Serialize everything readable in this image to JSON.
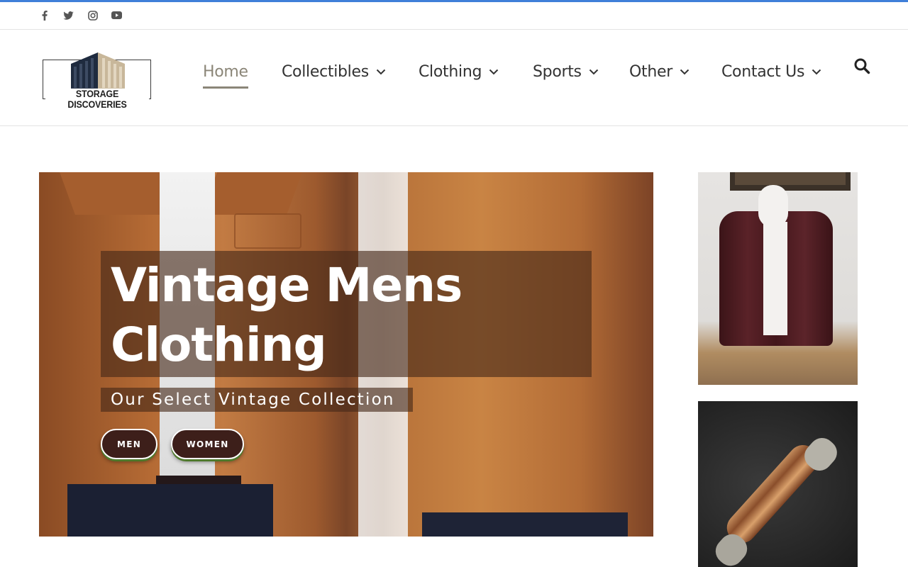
{
  "colors": {
    "accent": "#3f7fd9",
    "nav_active": "#8b8678",
    "nav_text": "#333333",
    "button_bg": "#3d1f1a"
  },
  "social": [
    {
      "icon": "facebook-icon"
    },
    {
      "icon": "twitter-icon"
    },
    {
      "icon": "instagram-icon"
    },
    {
      "icon": "youtube-icon"
    }
  ],
  "logo": {
    "text": "STORAGE DISCOVERIES"
  },
  "nav": {
    "items": [
      {
        "label": "Home",
        "active": true,
        "has_dropdown": false
      },
      {
        "label": "Collectibles",
        "active": false,
        "has_dropdown": true
      },
      {
        "label": "Clothing",
        "active": false,
        "has_dropdown": true
      },
      {
        "label": "Sports",
        "active": false,
        "has_dropdown": true
      },
      {
        "label": "Other",
        "active": false,
        "has_dropdown": true
      },
      {
        "label": "Contact Us",
        "active": false,
        "has_dropdown": true
      }
    ],
    "search_icon": "search-icon"
  },
  "hero": {
    "title": "Vintage Mens Clothing",
    "subtitle": "Our Select Vintage Collection",
    "buttons": [
      {
        "label": "MEN"
      },
      {
        "label": "WOMEN"
      }
    ]
  }
}
